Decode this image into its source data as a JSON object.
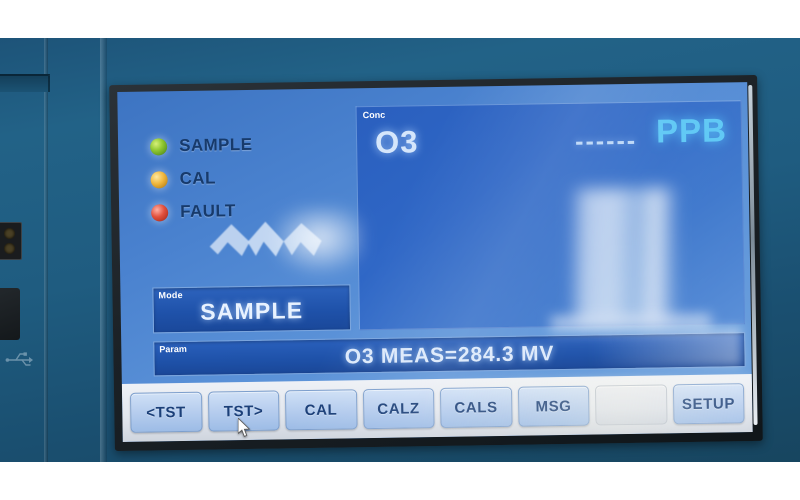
{
  "device": {
    "chassis_color": "#1f5c80",
    "screen_bg_color": "#4a82cf"
  },
  "status_leds": [
    {
      "label": "SAMPLE",
      "color": "#8fc730",
      "state": "green"
    },
    {
      "label": "CAL",
      "color": "#f0b63c",
      "state": "amber"
    },
    {
      "label": "FAULT",
      "color": "#e2503c",
      "state": "red"
    }
  ],
  "logo": {
    "name": "teledyne-chevron-logo",
    "color": "#e8f1fb"
  },
  "mode_field": {
    "tag": "Mode",
    "value": "SAMPLE"
  },
  "concentration_panel": {
    "tag": "Conc",
    "gas": "O3",
    "value": "------",
    "units": "PPB",
    "units_color": "#5fc8f5"
  },
  "param_bar": {
    "tag": "Param",
    "value": "O3 MEAS=284.3 MV"
  },
  "soft_keys": [
    {
      "label": "<TST",
      "name": "test-previous-button",
      "blank": false
    },
    {
      "label": "TST>",
      "name": "test-next-button",
      "blank": false
    },
    {
      "label": "CAL",
      "name": "calibrate-button",
      "blank": false
    },
    {
      "label": "CALZ",
      "name": "calibrate-zero-button",
      "blank": false
    },
    {
      "label": "CALS",
      "name": "calibrate-span-button",
      "blank": false
    },
    {
      "label": "MSG",
      "name": "message-button",
      "blank": false
    },
    {
      "label": "",
      "name": "blank-key",
      "blank": true
    },
    {
      "label": "SETUP",
      "name": "setup-button",
      "blank": false
    }
  ]
}
